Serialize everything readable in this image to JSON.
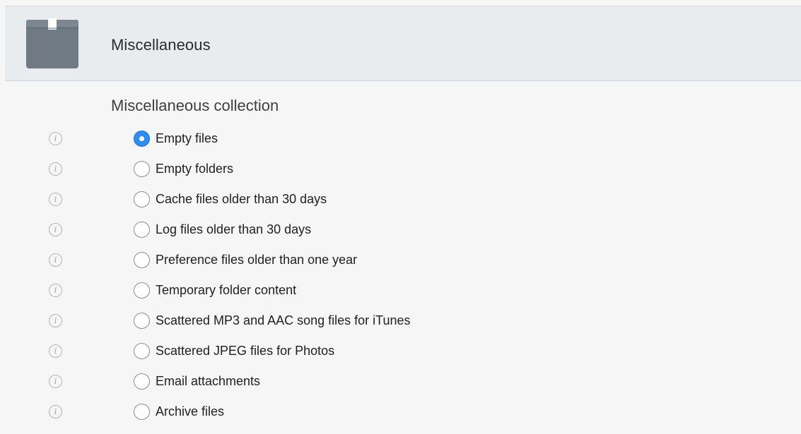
{
  "header": {
    "title": "Miscellaneous",
    "icon": "box-icon"
  },
  "section": {
    "title": "Miscellaneous collection"
  },
  "info_glyph": "i",
  "options": [
    {
      "label": "Empty files",
      "selected": true
    },
    {
      "label": "Empty folders",
      "selected": false
    },
    {
      "label": "Cache files older than 30 days",
      "selected": false
    },
    {
      "label": "Log files older than 30 days",
      "selected": false
    },
    {
      "label": "Preference files older than one year",
      "selected": false
    },
    {
      "label": "Temporary folder content",
      "selected": false
    },
    {
      "label": "Scattered MP3 and AAC song files for iTunes",
      "selected": false
    },
    {
      "label": "Scattered JPEG files for Photos",
      "selected": false
    },
    {
      "label": "Email attachments",
      "selected": false
    },
    {
      "label": "Archive files",
      "selected": false
    }
  ],
  "colors": {
    "accent": "#2d8cf5",
    "header_bg": "#e8ecee",
    "box_icon": "#6f7a85"
  }
}
